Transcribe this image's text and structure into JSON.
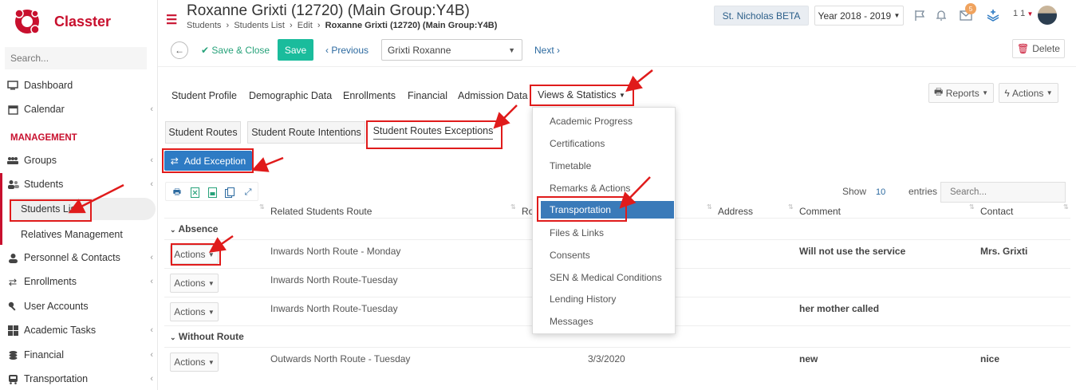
{
  "sidebar": {
    "logo_text": "Classter",
    "search_placeholder": "Search...",
    "items": [
      {
        "label": "Dashboard",
        "icon": "monitor-icon"
      },
      {
        "label": "Calendar",
        "icon": "calendar-icon"
      },
      {
        "label": "Groups",
        "icon": "groups-icon"
      },
      {
        "label": "Students",
        "icon": "students-icon"
      },
      {
        "label": "Personnel & Contacts",
        "icon": "personnel-icon"
      },
      {
        "label": "Enrollments",
        "icon": "arrows-icon"
      },
      {
        "label": "User Accounts",
        "icon": "key-icon"
      },
      {
        "label": "Academic Tasks",
        "icon": "grid-icon"
      },
      {
        "label": "Financial",
        "icon": "coins-icon"
      },
      {
        "label": "Transportation",
        "icon": "bus-icon"
      }
    ],
    "section": "MANAGEMENT",
    "sub_items": [
      "Students List",
      "Relatives Management"
    ]
  },
  "header": {
    "title": "Roxanne Grixti (12720) (Main Group:Y4B)",
    "breadcrumb": [
      "Students",
      "Students List",
      "Edit",
      "Roxanne Grixti (12720) (Main Group:Y4B)"
    ],
    "institution": "St. Nicholas BETA",
    "year": "Year 2018 - 2019",
    "mail_badge": "5",
    "user_count": "1 1"
  },
  "toolbar": {
    "save_close": "Save & Close",
    "save": "Save",
    "previous": "Previous",
    "student_value": "Grixti Roxanne",
    "next": "Next",
    "delete": "Delete"
  },
  "tabs": [
    "Student Profile",
    "Demographic Data",
    "Enrollments",
    "Financial",
    "Admission Data",
    "Views & Statistics"
  ],
  "right_buttons": {
    "reports": "Reports",
    "actions": "Actions"
  },
  "subtabs": [
    "Student Routes",
    "Student Route Intentions",
    "Student Routes Exceptions"
  ],
  "add_exception": "Add Exception",
  "table": {
    "show_label": "Show",
    "show_value": "10",
    "entries_label": "entries",
    "search_placeholder": "Search...",
    "headers": [
      "Related Students Route",
      "Ro",
      "Address",
      "Comment",
      "Contact"
    ],
    "groups": [
      {
        "name": "Absence",
        "rows": [
          {
            "action": "Actions",
            "route": "Inwards North Route - Monday",
            "date": "",
            "comment": "Will not use the service",
            "contact": "Mrs. Grixti"
          },
          {
            "action": "Actions",
            "route": "Inwards North Route-Tuesday",
            "date": "",
            "comment": "",
            "contact": ""
          },
          {
            "action": "Actions",
            "route": "Inwards North Route-Tuesday",
            "date": "",
            "comment": "her mother called",
            "contact": ""
          }
        ]
      },
      {
        "name": "Without Route",
        "rows": [
          {
            "action": "Actions",
            "route": "Outwards North Route - Tuesday",
            "date": "3/3/2020",
            "comment": "new",
            "contact": "nice"
          }
        ]
      }
    ]
  },
  "dropdown": {
    "items": [
      "Academic Progress",
      "Certifications",
      "Timetable",
      "Remarks & Actions",
      "Transportation",
      "Files & Links",
      "Consents",
      "SEN & Medical Conditions",
      "Lending History",
      "Messages"
    ],
    "selected": "Transportation"
  },
  "colors": {
    "brand": "#c8102e",
    "primary": "#2e7bc4",
    "save": "#1abc9c",
    "annotation": "#e01b1b"
  }
}
